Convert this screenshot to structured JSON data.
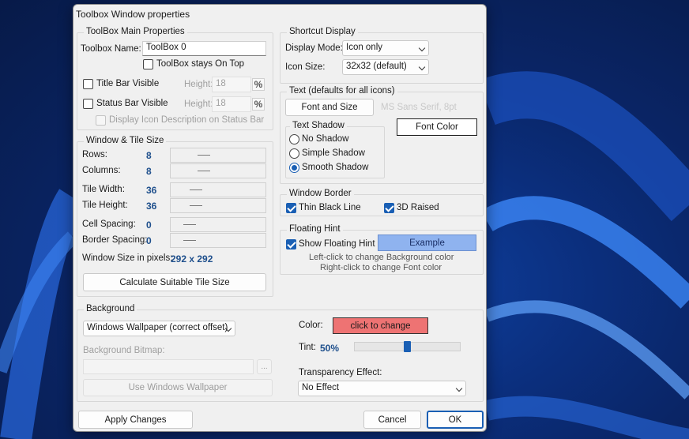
{
  "window": {
    "title": "Toolbox Window properties"
  },
  "main_props": {
    "legend": "ToolBox Main Properties",
    "name_label": "Toolbox Name:",
    "name_value": "ToolBox 0",
    "stays_on_top": {
      "label": "ToolBox stays On Top",
      "checked": false
    },
    "title_bar": {
      "label": "Title Bar Visible",
      "checked": false,
      "height_label": "Height:",
      "height_value": "18"
    },
    "status_bar": {
      "label": "Status Bar Visible",
      "checked": false,
      "height_label": "Height:",
      "height_value": "18"
    },
    "icon_desc": {
      "label": "Display Icon Description on Status Bar",
      "checked": false
    },
    "pct_glyph": "%"
  },
  "tile_size": {
    "legend": "Window & Tile Size",
    "rows": {
      "label": "Rows:",
      "value": "8"
    },
    "columns": {
      "label": "Columns:",
      "value": "8"
    },
    "tile_width": {
      "label": "Tile Width:",
      "value": "36"
    },
    "tile_height": {
      "label": "Tile Height:",
      "value": "36"
    },
    "cell_spacing": {
      "label": "Cell Spacing:",
      "value": "0"
    },
    "border_spacing": {
      "label": "Border Spacing:",
      "value": "0"
    },
    "window_size_label": "Window Size in pixels:",
    "window_size_value": "292 x 292",
    "calc_button": "Calculate Suitable Tile Size"
  },
  "shortcut": {
    "legend": "Shortcut Display",
    "display_mode_label": "Display Mode:",
    "display_mode_value": "Icon only",
    "icon_size_label": "Icon Size:",
    "icon_size_value": "32x32 (default)"
  },
  "text": {
    "legend": "Text (defaults for all icons)",
    "font_button": "Font and Size",
    "font_name": "MS Sans Serif, 8pt",
    "font_color_button": "Font Color",
    "shadow_legend": "Text Shadow",
    "shadow_options": [
      "No Shadow",
      "Simple Shadow",
      "Smooth Shadow"
    ],
    "shadow_selected": "Smooth Shadow"
  },
  "border": {
    "legend": "Window Border",
    "thin_black": {
      "label": "Thin Black Line",
      "checked": true
    },
    "raised": {
      "label": "3D Raised",
      "checked": true
    }
  },
  "hint": {
    "legend": "Floating Hint",
    "show": {
      "label": "Show Floating Hint",
      "checked": true
    },
    "example": "Example",
    "line1": "Left-click to change Background color",
    "line2": "Right-click to change Font color"
  },
  "background": {
    "legend": "Background",
    "mode_value": "Windows Wallpaper (correct offset)",
    "bitmap_label": "Background Bitmap:",
    "bitmap_value": "",
    "browse": "...",
    "use_wallpaper": "Use Windows Wallpaper",
    "color_label": "Color:",
    "color_button": "click to change",
    "tint_label": "Tint:",
    "tint_value": "50%",
    "tint_fraction": 0.5,
    "transparency_label": "Transparency Effect:",
    "transparency_value": "No Effect"
  },
  "footer": {
    "apply": "Apply Changes",
    "cancel": "Cancel",
    "ok": "OK"
  },
  "colors": {
    "accent": "#1a5fb4",
    "value_blue": "#1e4f8c",
    "bg_color_swatch": "#ee7373",
    "example_swatch": "#8fb3ef",
    "font_name_color": "#c8c8c8"
  }
}
